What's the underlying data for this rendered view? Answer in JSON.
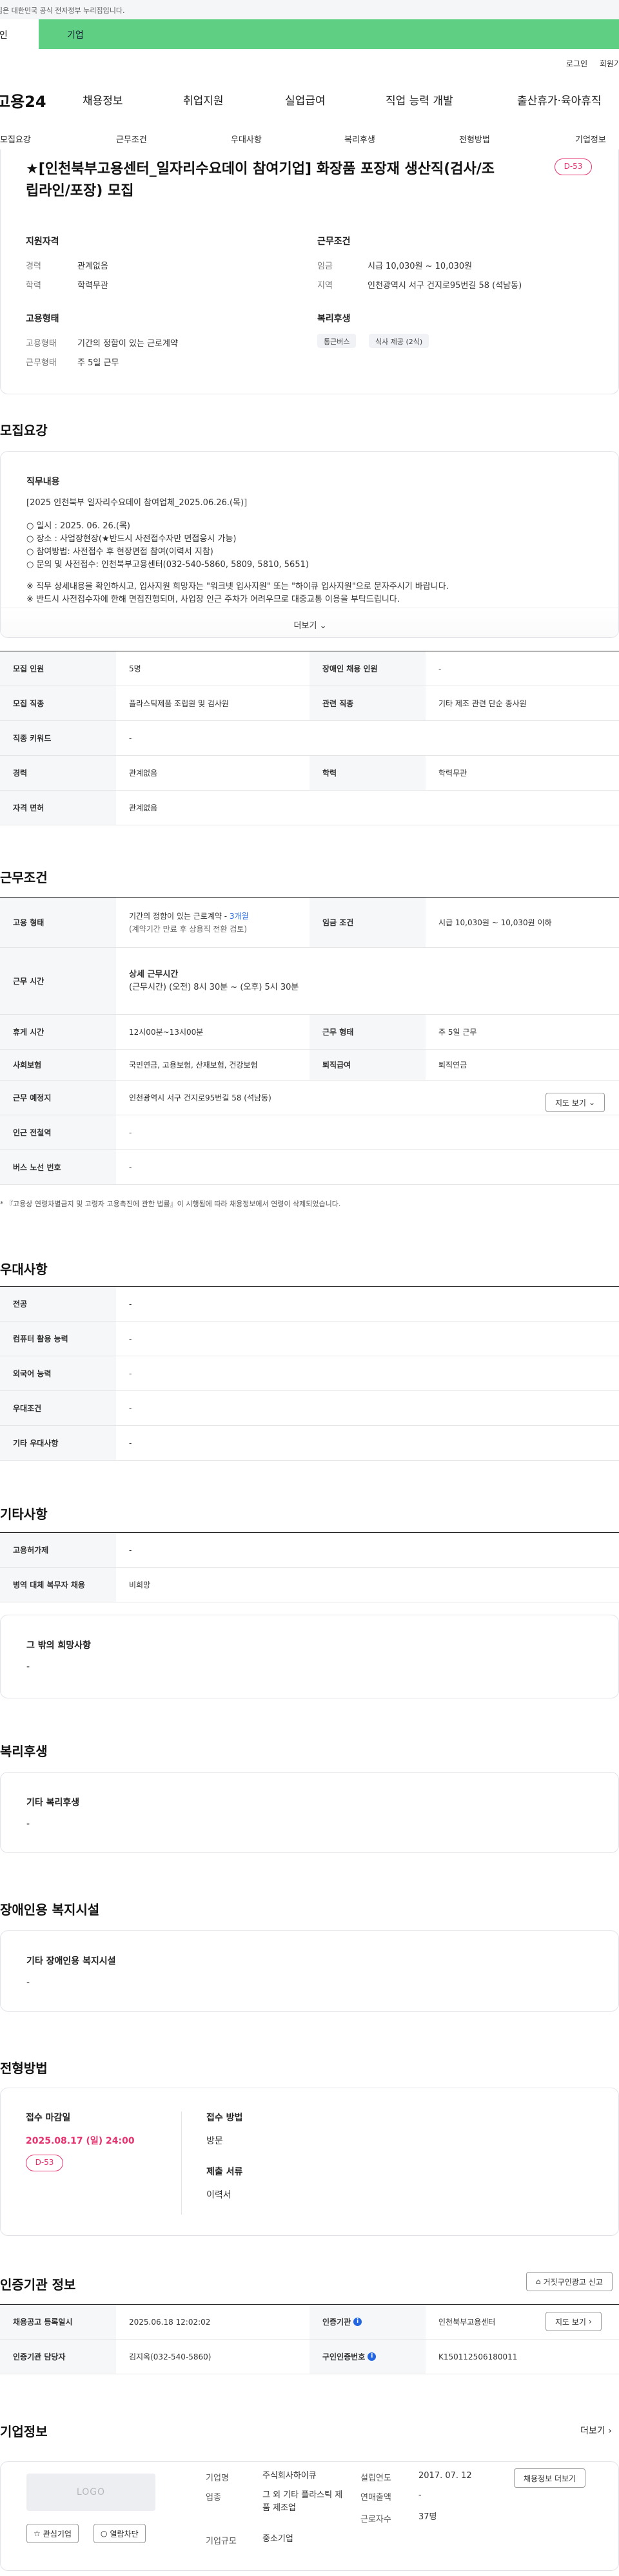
{
  "gov_banner": "이 누리집은 대한민국 공식 전자정부 누리집입니다.",
  "tabs": {
    "personal": "개인",
    "corporate": "기업"
  },
  "util": {
    "login": "로그인",
    "signup": "회원가입"
  },
  "gnb": {
    "logo": "고용24",
    "menu": [
      "채용정보",
      "취업지원",
      "실업급여",
      "직업 능력 개발",
      "출산휴가·육아휴직"
    ]
  },
  "anchors": [
    "모집요강",
    "근무조건",
    "우대사항",
    "복리후생",
    "전형방법",
    "기업정보"
  ],
  "job": {
    "title": "★[인천북부고용센터_일자리수요데이 참여기업] 화장품 포장재 생산직(검사/조립라인/포장) 모집",
    "dday": "D-53"
  },
  "summary": {
    "qual_title": "지원자격",
    "career_label": "경력",
    "career_value": "관계없음",
    "edu_label": "학력",
    "edu_value": "학력무관",
    "form_title": "고용형태",
    "emp_label": "고용형태",
    "emp_value": "기간의 정함이 있는 근로계약",
    "work_label": "근무형태",
    "work_value": "주 5일 근무",
    "cond_title": "근무조건",
    "wage_label": "임금",
    "wage_value": "시급 10,030원 ~ 10,030원",
    "region_label": "지역",
    "region_value": "인천광역시 서구 건지로95번길 58 (석남동)",
    "welfare_title": "복리후생",
    "welfare_chips": [
      "통근버스",
      "식사 제공 (2식)"
    ]
  },
  "recruit": {
    "section_title": "모집요강",
    "desc_heading": "직무내용",
    "desc_lines": [
      "[2025 인천북부 일자리수요데이 참여업체_2025.06.26.(목)]",
      "",
      "○ 일시 : 2025. 06. 26.(목)",
      "○ 장소 : 사업장현장(★반드시 사전접수자만 면접응시 가능)",
      "○ 참여방법: 사전접수 후 현장면접 참여(이력서 지참)",
      "○ 문의 및 사전접수: 인천북부고용센터(032-540-5860, 5809, 5810, 5651)",
      "",
      "※ 직무 상세내용을 확인하시고, 입사지원 희망자는 \"워크넷 입사지원\" 또는 \"하이큐 입사지원\"으로 문자주시기 바랍니다.",
      "※ 반드시 사전접수자에 한해 면접진행되며, 사업장 인근 주차가 어려우므로 대중교통 이용을 부탁드립니다."
    ],
    "more_label": "더보기",
    "rows": [
      [
        "모집 인원",
        "5명",
        "장애인 채용 인원",
        "-"
      ],
      [
        "모집 직종",
        "플라스틱제품 조립원 및 검사원",
        "관련 직종",
        "기타 제조 관련 단순 종사원"
      ],
      [
        "직종 키워드",
        "-",
        "",
        ""
      ],
      [
        "경력",
        "관계없음",
        "학력",
        "학력무관"
      ],
      [
        "자격 면허",
        "관계없음",
        "",
        ""
      ]
    ]
  },
  "work": {
    "section_title": "근무조건",
    "emp_type_label": "고용 형태",
    "emp_type_value": "기간의 정함이 있는 근로계약 - ",
    "emp_type_months": "3개월",
    "emp_type_sub": "(계약기간 만료 후 상용직 전환 검토)",
    "wage_label": "임금 조건",
    "wage_value": "시급 10,030원 ~ 10,030원 이하",
    "hours_label": "근무 시간",
    "hours_head": "상세 근무시간",
    "hours_value": "(근무시간) (오전) 8시 30분 ~ (오후) 5시 30분",
    "break_label": "휴게 시간",
    "break_value": "12시00분~13시00분",
    "form_label": "근무 형태",
    "form_value": "주 5일 근무",
    "insurance_label": "사회보험",
    "insurance_value": "국민연금, 고용보험, 산재보험, 건강보험",
    "retire_label": "퇴직급여",
    "retire_value": "퇴직연금",
    "place_label": "근무 예정지",
    "place_value": "인천광역시 서구 건지로95번길 58 (석남동)",
    "map_btn": "지도 보기",
    "subway_label": "인근 전철역",
    "subway_value": "-",
    "bus_label": "버스 노선 번호",
    "bus_value": "-",
    "note": "* 『고용상 연령차별금지 및 고령자 고용촉진에 관한 법률』이 시행됨에 따라 채용정보에서 연령이 삭제되었습니다."
  },
  "prefer": {
    "section_title": "우대사항",
    "rows": [
      [
        "전공",
        "-"
      ],
      [
        "컴퓨터 활용 능력",
        "-"
      ],
      [
        "외국어 능력",
        "-"
      ],
      [
        "우대조건",
        "-"
      ],
      [
        "기타 우대사항",
        "-"
      ]
    ]
  },
  "etc": {
    "section_title": "기타사항",
    "rows": [
      [
        "고용허가제",
        "-"
      ],
      [
        "병역 대체 복무자 채용",
        "비희망"
      ]
    ],
    "other_heading": "그 밖의 희망사항",
    "other_value": "-"
  },
  "welfare": {
    "section_title": "복리후생",
    "heading": "기타 복리후생",
    "value": "-"
  },
  "disabled": {
    "section_title": "장애인용 복지시설",
    "heading": "기타 장애인용 복지시설",
    "value": "-"
  },
  "selection": {
    "section_title": "전형방법",
    "deadline_label": "접수 마감일",
    "deadline_value": "2025.08.17 (일) 24:00",
    "dday": "D-53",
    "method_label": "접수 방법",
    "method_value": "방문",
    "docs_label": "제출 서류",
    "docs_value": "이력서"
  },
  "agency": {
    "section_title": "인증기관 정보",
    "report_btn": "거짓구인광고 신고",
    "reg_label": "채용공고 등록일시",
    "reg_value": "2025.06.18 12:02:02",
    "agency_label": "인증기관",
    "agency_value": "인천북부고용센터",
    "map_btn": "지도 보기",
    "manager_label": "인증기관 담당자",
    "manager_value": "김지옥(032-540-5860)",
    "id_label": "구인인증번호",
    "id_value": "K150112506180011"
  },
  "company": {
    "section_title": "기업정보",
    "more": "더보기",
    "logo_placeholder": "LOGO",
    "interest_btn": "관심기업",
    "block_btn": "열람차단",
    "name_label": "기업명",
    "name_value": "주식회사하이큐",
    "industry_label": "업종",
    "industry_value": "그 외 기타 플라스틱 제품 제조업",
    "scale_label": "기업규모",
    "scale_value": "중소기업",
    "founded_label": "설립연도",
    "founded_value": "2017. 07. 12",
    "sales_label": "연매출액",
    "sales_value": "-",
    "employees_label": "근로자수",
    "employees_value": "37명",
    "jobs_btn": "채용정보 더보기"
  }
}
